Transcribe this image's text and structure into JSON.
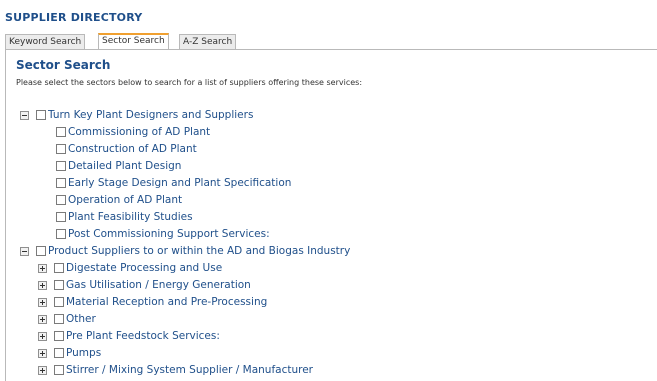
{
  "header": {
    "title": "SUPPLIER DIRECTORY"
  },
  "tabs": [
    {
      "label": "Keyword Search",
      "active": false
    },
    {
      "label": "Sector Search",
      "active": true
    },
    {
      "label": "A-Z Search",
      "active": false
    }
  ],
  "sector": {
    "title": "Sector Search",
    "instructions": "Please select the sectors below to search for a list of suppliers offering these services:"
  },
  "tree": {
    "group1": {
      "label": "Turn Key Plant Designers and Suppliers",
      "expanded": true,
      "items": [
        "Commissioning of AD Plant",
        "Construction of AD Plant",
        "Detailed Plant Design",
        "Early Stage Design and Plant Specification",
        "Operation of AD Plant",
        "Plant Feasibility Studies",
        "Post Commissioning Support Services:"
      ]
    },
    "group2": {
      "label": "Product Suppliers to or within the AD and Biogas Industry",
      "expanded": true,
      "items": [
        "Digestate Processing and Use",
        "Gas Utilisation / Energy Generation",
        "Material Reception and Pre-Processing",
        "Other",
        "Pre Plant Feedstock Services:",
        "Pumps",
        "Stirrer / Mixing System Supplier / Manufacturer"
      ]
    }
  },
  "colors": {
    "link": "#1f4f8a",
    "tab_active_accent": "#f0a030",
    "border": "#b9b9b9"
  }
}
